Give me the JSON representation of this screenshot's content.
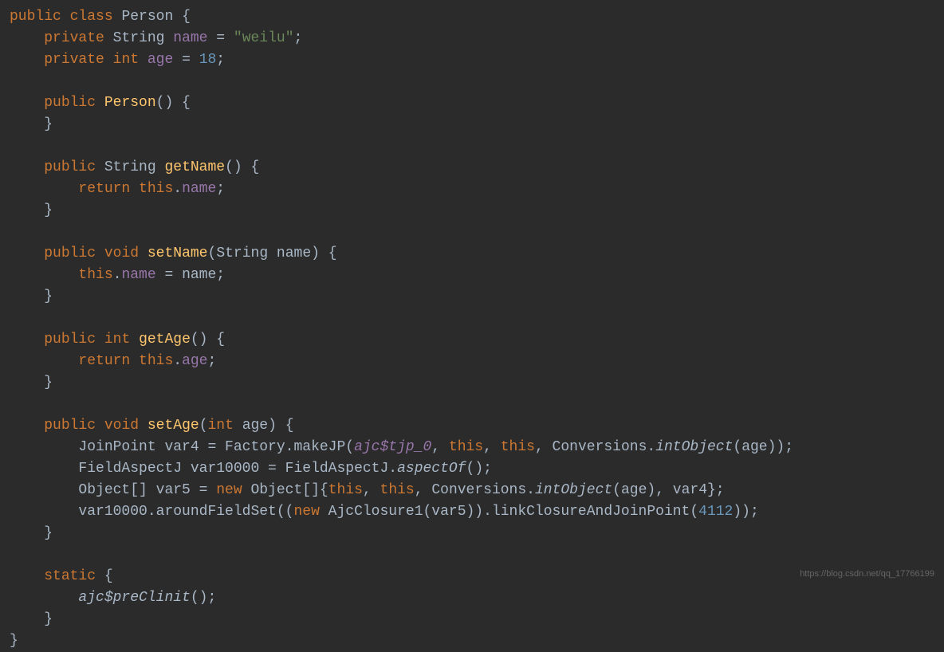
{
  "code": {
    "line1": {
      "kw_public": "public",
      "kw_class": "class",
      "class_name": "Person",
      "brace": " {"
    },
    "line2": {
      "kw_private": "private",
      "type": "String",
      "field": "name",
      "eq": " = ",
      "value": "\"weilu\"",
      "semi": ";"
    },
    "line3": {
      "kw_private": "private",
      "kw_int": "int",
      "field": "age",
      "eq": " = ",
      "value": "18",
      "semi": ";"
    },
    "line5": {
      "kw_public": "public",
      "method": "Person",
      "parens": "() {"
    },
    "line6": {
      "brace": "}"
    },
    "line8": {
      "kw_public": "public",
      "type": "String",
      "method": "getName",
      "parens": "() {"
    },
    "line9": {
      "kw_return": "return",
      "kw_this": "this",
      "dot": ".",
      "field": "name",
      "semi": ";"
    },
    "line10": {
      "brace": "}"
    },
    "line12": {
      "kw_public": "public",
      "kw_void": "void",
      "method": "setName",
      "lparen": "(",
      "type": "String",
      "param": " name",
      "rparen": ") {"
    },
    "line13": {
      "kw_this": "this",
      "dot": ".",
      "field": "name",
      "eq": " = name",
      "semi": ";"
    },
    "line14": {
      "brace": "}"
    },
    "line16": {
      "kw_public": "public",
      "kw_int": "int",
      "method": "getAge",
      "parens": "() {"
    },
    "line17": {
      "kw_return": "return",
      "kw_this": "this",
      "dot": ".",
      "field": "age",
      "semi": ";"
    },
    "line18": {
      "brace": "}"
    },
    "line20": {
      "kw_public": "public",
      "kw_void": "void",
      "method": "setAge",
      "lparen": "(",
      "kw_int": "int",
      "param": " age",
      "rparen": ") {"
    },
    "line21": {
      "type1": "JoinPoint var4 = Factory.makeJP(",
      "static_field": "ajc$tjp_0",
      "comma1": ", ",
      "this1": "this",
      "comma2": ", ",
      "this2": "this",
      "comma3": ", Conversions.",
      "italic_method": "intObject",
      "end": "(age));"
    },
    "line22": {
      "text1": "FieldAspectJ var10000 = FieldAspectJ.",
      "italic_method": "aspectOf",
      "end": "();"
    },
    "line23": {
      "text1": "Object[] var5 = ",
      "kw_new": "new",
      "text2": " Object[]{",
      "this1": "this",
      "comma1": ", ",
      "this2": "this",
      "comma2": ", Conversions.",
      "italic_method": "intObject",
      "end": "(age), var4};"
    },
    "line24": {
      "text1": "var10000.aroundFieldSet((",
      "kw_new": "new",
      "text2": " AjcClosure1(var5)).linkClosureAndJoinPoint(",
      "number": "4112",
      "end": "));"
    },
    "line25": {
      "brace": "}"
    },
    "line27": {
      "kw_static": "static",
      "brace": " {"
    },
    "line28": {
      "method": "ajc$preClinit",
      "parens": "();"
    },
    "line29": {
      "brace": "}"
    },
    "line30": {
      "brace": "}"
    }
  },
  "watermark": "https://blog.csdn.net/qq_17766199"
}
